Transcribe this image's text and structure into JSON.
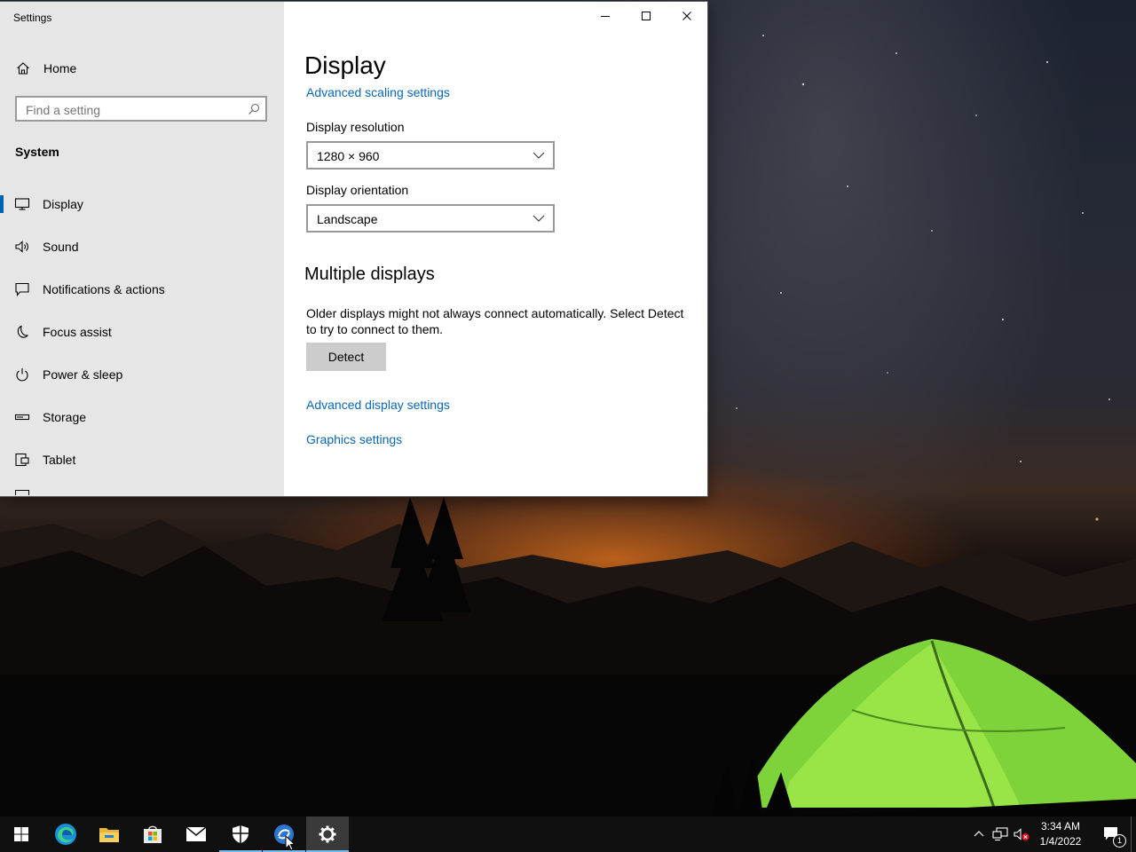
{
  "window": {
    "title": "Settings"
  },
  "sidebar": {
    "home_label": "Home",
    "search_placeholder": "Find a setting",
    "section": "System",
    "items": [
      {
        "label": "Display",
        "icon": "monitor-icon",
        "active": true
      },
      {
        "label": "Sound",
        "icon": "speaker-icon"
      },
      {
        "label": "Notifications & actions",
        "icon": "message-icon"
      },
      {
        "label": "Focus assist",
        "icon": "moon-icon"
      },
      {
        "label": "Power & sleep",
        "icon": "power-icon"
      },
      {
        "label": "Storage",
        "icon": "storage-icon"
      },
      {
        "label": "Tablet",
        "icon": "tablet-icon"
      }
    ]
  },
  "content": {
    "title": "Display",
    "advanced_scaling_link": "Advanced scaling settings",
    "resolution_label": "Display resolution",
    "resolution_value": "1280 × 960",
    "orientation_label": "Display orientation",
    "orientation_value": "Landscape",
    "multiple_heading": "Multiple displays",
    "multiple_text": "Older displays might not always connect automatically. Select Detect to try to connect to them.",
    "detect_button": "Detect",
    "advanced_display_link": "Advanced display settings",
    "graphics_link": "Graphics settings"
  },
  "taskbar": {
    "apps": [
      "start-icon",
      "edge-icon",
      "file-explorer-icon",
      "store-icon",
      "mail-icon",
      "security-icon",
      "remote-app-icon",
      "settings-icon"
    ],
    "time": "3:34 AM",
    "date": "1/4/2022",
    "notification_count": "1"
  },
  "colors": {
    "accent": "#0063b1",
    "link": "#0b66b3",
    "tent": "#7ed23a"
  }
}
